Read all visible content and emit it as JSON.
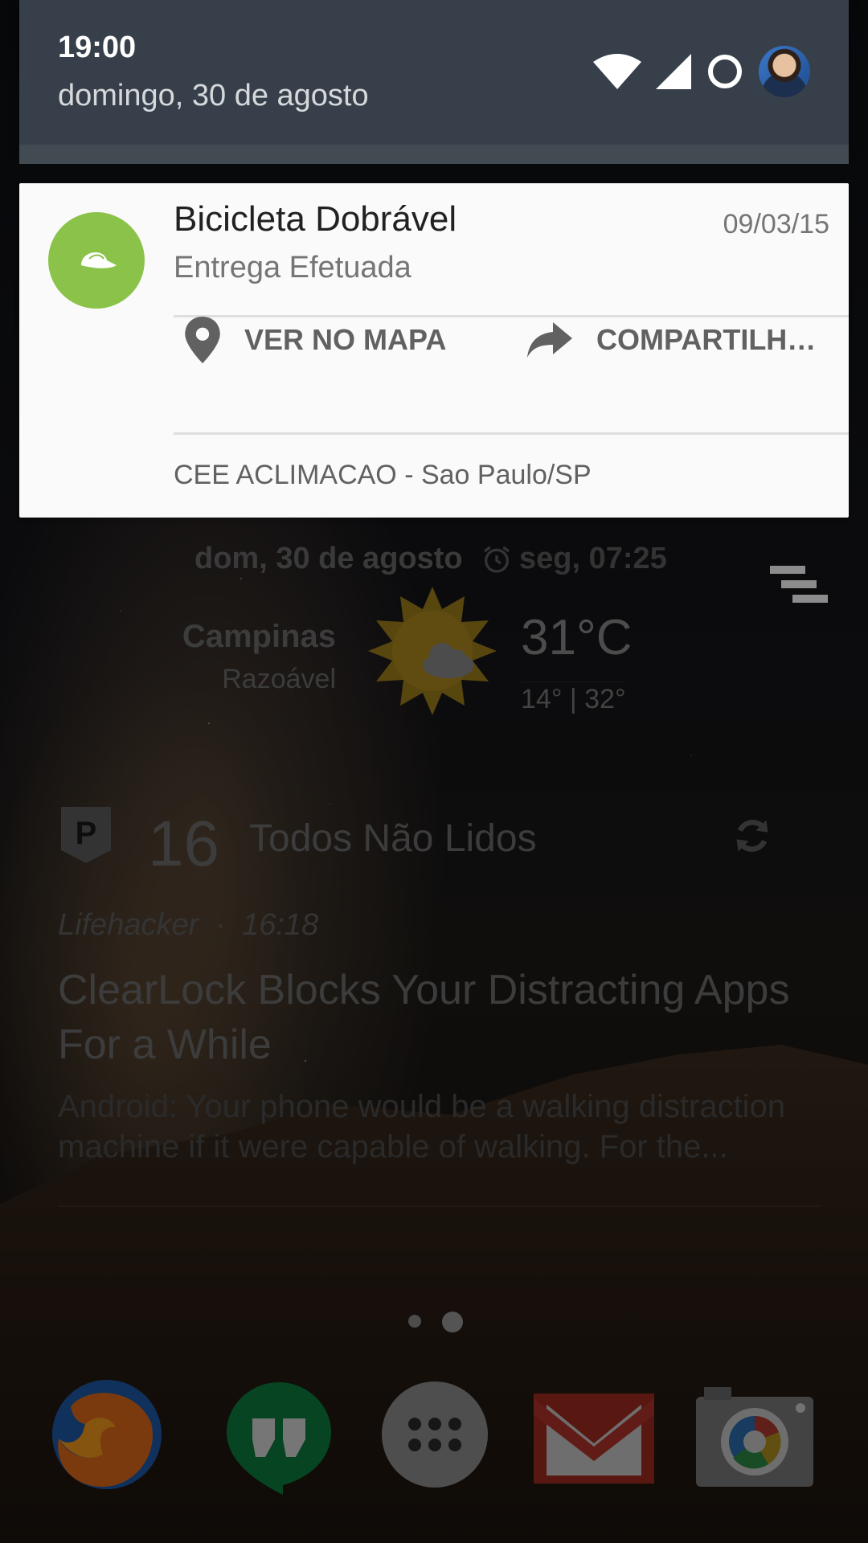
{
  "status": {
    "time": "19:00",
    "date": "domingo, 30 de agosto",
    "icons": [
      "wifi-icon",
      "cell-signal-icon",
      "alarm-ring-icon",
      "avatar"
    ]
  },
  "notification": {
    "icon": "cap-icon",
    "accent": "#8bc34a",
    "title": "Bicicleta Dobrável",
    "time": "09/03/15",
    "subtitle": "Entrega Efetuada",
    "actions": [
      {
        "icon": "location-pin-icon",
        "label": "VER NO MAPA"
      },
      {
        "icon": "share-arrow-icon",
        "label": "COMPARTILH…"
      }
    ],
    "footer": "CEE ACLIMACAO - Sao Paulo/SP"
  },
  "clock_widget": {
    "date": "dom, 30 de agosto",
    "alarm": "seg, 07:25",
    "city": "Campinas",
    "condition": "Razoável",
    "temperature": "31°C",
    "range": "14° | 32°"
  },
  "news_widget": {
    "count": "16",
    "filter": "Todos Não Lidos",
    "source": "Lifehacker",
    "separator": "·",
    "time": "16:18",
    "headline": "ClearLock Blocks Your Distracting Apps For a While",
    "excerpt": "Android: Your phone would be a walking distraction machine if it were capable of walking. For the..."
  },
  "page_indicator": {
    "pages": 2,
    "current": 2
  },
  "dock": [
    "firefox-icon",
    "hangouts-icon",
    "app-drawer-icon",
    "gmail-icon",
    "camera-icon"
  ]
}
